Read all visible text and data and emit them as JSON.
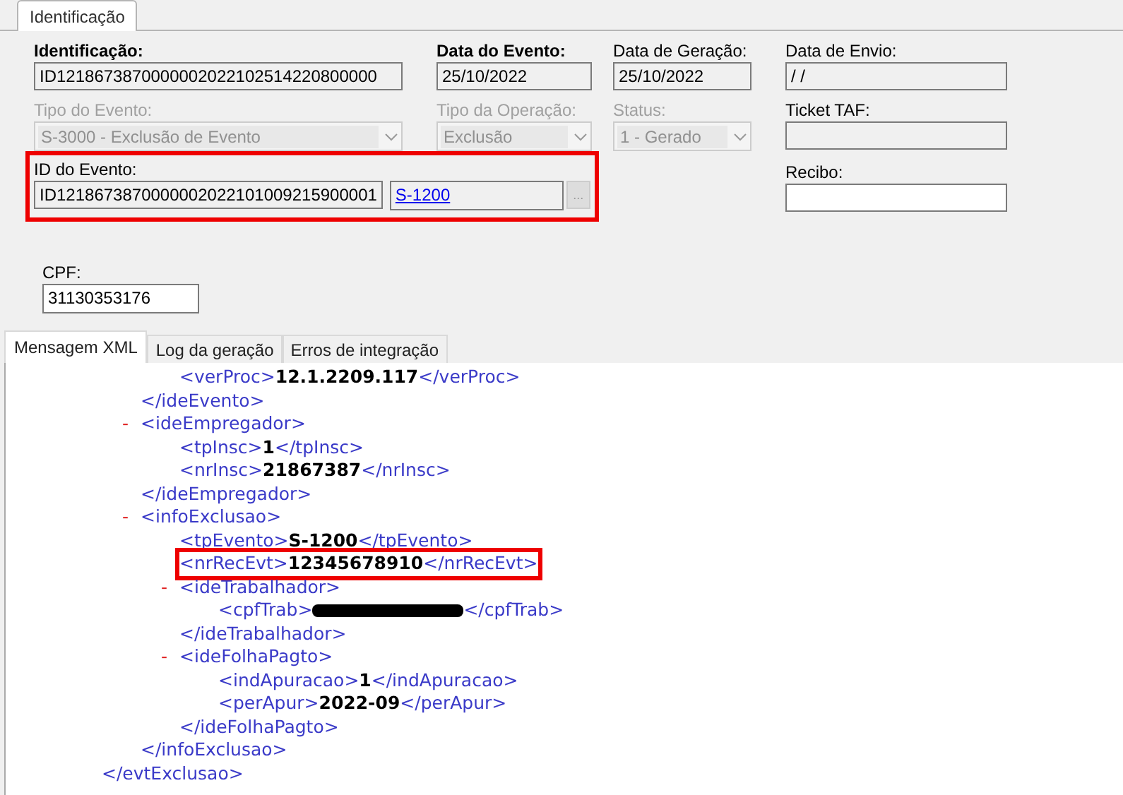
{
  "tabs": [
    {
      "label": "Identificação",
      "selected": true
    }
  ],
  "rows": [
    [
      {
        "kind": "text",
        "label": "Identificação:",
        "label_bold": true,
        "value": "ID1218673870000002022102514220800000",
        "disabled": false
      },
      {
        "kind": "text",
        "label": "Data do Evento:",
        "label_bold": true,
        "value": "25/10/2022",
        "disabled": false
      },
      {
        "kind": "text",
        "label": "Data de Geração:",
        "label_bold": false,
        "value": "25/10/2022",
        "disabled": false
      },
      {
        "kind": "text",
        "label": "Data de Envio:",
        "label_bold": false,
        "value": "/ /",
        "disabled": false
      }
    ],
    [
      {
        "kind": "select",
        "label": "Tipo do Evento:",
        "label_bold": false,
        "value": "S-3000 - Exclusão de Evento",
        "disabled": true
      },
      {
        "kind": "select",
        "label": "Tipo da Operação:",
        "label_bold": false,
        "value": "Exclusão",
        "disabled": true
      },
      {
        "kind": "select",
        "label": "Status:",
        "label_bold": false,
        "value": "1 - Gerado",
        "disabled": true
      },
      {
        "kind": "text",
        "label": "Ticket TAF:",
        "label_bold": false,
        "disabled": false
      }
    ],
    [
      {
        "kind": "event_id",
        "label": "ID do Evento:",
        "label_bold": false,
        "value": "ID1218673870000002022101009215900001",
        "link": "S-1200",
        "button": "...",
        "highlighted": true,
        "disabled": false
      },
      {
        "kind": "text",
        "label": "Recibo:",
        "label_bold": false,
        "disabled": false,
        "white": true
      }
    ]
  ],
  "cpf": {
    "label": "CPF:",
    "value": "31130353176"
  },
  "bottom_tabs": [
    {
      "label": "Mensagem XML",
      "selected": true
    },
    {
      "label": "Log da geração",
      "selected": false
    },
    {
      "label": "Erros de integração",
      "selected": false
    }
  ],
  "xml": [
    {
      "close": "</evtExclusao>",
      "children": [
        {
          "close": "</ideEvento>",
          "children": [
            {
              "open": "<verProc>",
              "value": "12.1.2209.117",
              "close": "</verProc>"
            }
          ]
        },
        {
          "toggle": "-",
          "open": "<ideEmpregador>",
          "close": "</ideEmpregador>",
          "children": [
            {
              "open": "<tpInsc>",
              "value": "1",
              "close": "</tpInsc>"
            },
            {
              "open": "<nrInsc>",
              "value": "21867387",
              "close": "</nrInsc>"
            }
          ]
        },
        {
          "toggle": "-",
          "open": "<infoExclusao>",
          "close": "</infoExclusao>",
          "children": [
            {
              "open": "<tpEvento>",
              "value": "S-1200",
              "close": "</tpEvento>"
            },
            {
              "open": "<nrRecEvt>",
              "value": "12345678910",
              "close": "</nrRecEvt>",
              "highlighted": true
            },
            {
              "toggle": "-",
              "open": "<ideTrabalhador>",
              "close": "</ideTrabalhador>",
              "children": [
                {
                  "open": "<cpfTrab>",
                  "redacted": true,
                  "close": "</cpfTrab>"
                }
              ]
            },
            {
              "toggle": "-",
              "open": "<ideFolhaPagto>",
              "close": "</ideFolhaPagto>",
              "children": [
                {
                  "open": "<indApuracao>",
                  "value": "1",
                  "close": "</indApuracao>"
                },
                {
                  "open": "<perApur>",
                  "value": "2022-09",
                  "close": "</perApur>"
                }
              ]
            }
          ]
        }
      ]
    }
  ]
}
